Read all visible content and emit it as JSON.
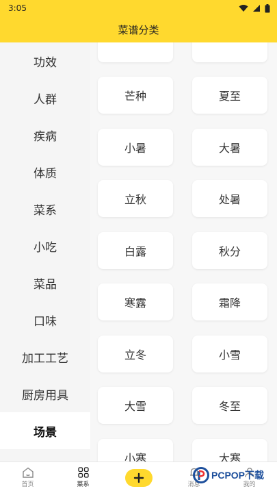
{
  "status_bar": {
    "time": "3:05"
  },
  "header": {
    "title": "菜谱分类"
  },
  "sidebar": {
    "items": [
      {
        "label": "功效"
      },
      {
        "label": "人群"
      },
      {
        "label": "疾病"
      },
      {
        "label": "体质"
      },
      {
        "label": "菜系"
      },
      {
        "label": "小吃"
      },
      {
        "label": "菜品"
      },
      {
        "label": "口味"
      },
      {
        "label": "加工工艺"
      },
      {
        "label": "厨房用具"
      },
      {
        "label": "场景"
      }
    ]
  },
  "grid": {
    "rows": [
      [
        "芒种",
        "夏至"
      ],
      [
        "小暑",
        "大暑"
      ],
      [
        "立秋",
        "处暑"
      ],
      [
        "白露",
        "秋分"
      ],
      [
        "寒露",
        "霜降"
      ],
      [
        "立冬",
        "小雪"
      ],
      [
        "大雪",
        "冬至"
      ],
      [
        "小寒",
        "大寒"
      ]
    ]
  },
  "tabbar": {
    "home": "首页",
    "category": "菜系",
    "add": "+",
    "message": "消息",
    "mine": "我的"
  },
  "watermark": {
    "text": "PCPOP下载"
  },
  "colors": {
    "accent": "#ffd92e",
    "sidebar_bg": "#f5f5f5",
    "content_bg": "#f7f7f7"
  }
}
